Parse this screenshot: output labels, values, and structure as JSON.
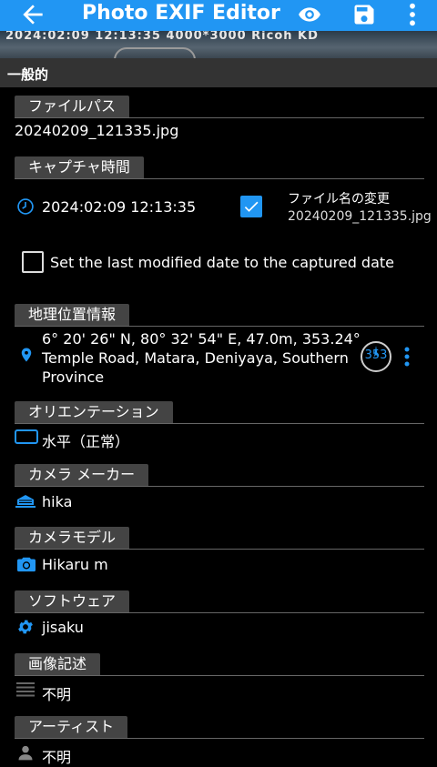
{
  "appbar": {
    "title": "Photo EXIF Editor"
  },
  "preview": {
    "overlay_text": "2024:02:09 12:13:35 4000*3000 Ricoh KD"
  },
  "section": {
    "label": "一般的"
  },
  "fields": {
    "file_path": {
      "header": "ファイルパス",
      "value": "20240209_121335.jpg"
    },
    "capture_time": {
      "header": "キャプチャ時間",
      "value": "2024:02:09 12:13:35",
      "rename_label": "ファイル名の変更",
      "rename_value": "20240209_121335.jpg",
      "rename_checked": true
    },
    "last_modified": {
      "label": "Set the last modified date to the captured date",
      "checked": false
    },
    "geo": {
      "header": "地理位置情報",
      "line1": "6° 20' 26\" N, 80° 32' 54\" E,  47.0m, 353.24°",
      "line2": "Temple Road, Matara, Deniyaya, Southern",
      "line3": "Province",
      "bearing": "353"
    },
    "orientation": {
      "header": "オリエンテーション",
      "value": "水平（正常）"
    },
    "camera_maker": {
      "header": "カメラ メーカー",
      "value": "hika"
    },
    "camera_model": {
      "header": "カメラモデル",
      "value": "Hikaru m"
    },
    "software": {
      "header": "ソフトウェア",
      "value": "jisaku"
    },
    "image_description": {
      "header": "画像記述",
      "value": "不明"
    },
    "artist": {
      "header": "アーティスト",
      "value": "不明"
    }
  },
  "colors": {
    "accent": "#2196F3",
    "tab_bg": "#444444",
    "section_bg": "#333333"
  }
}
